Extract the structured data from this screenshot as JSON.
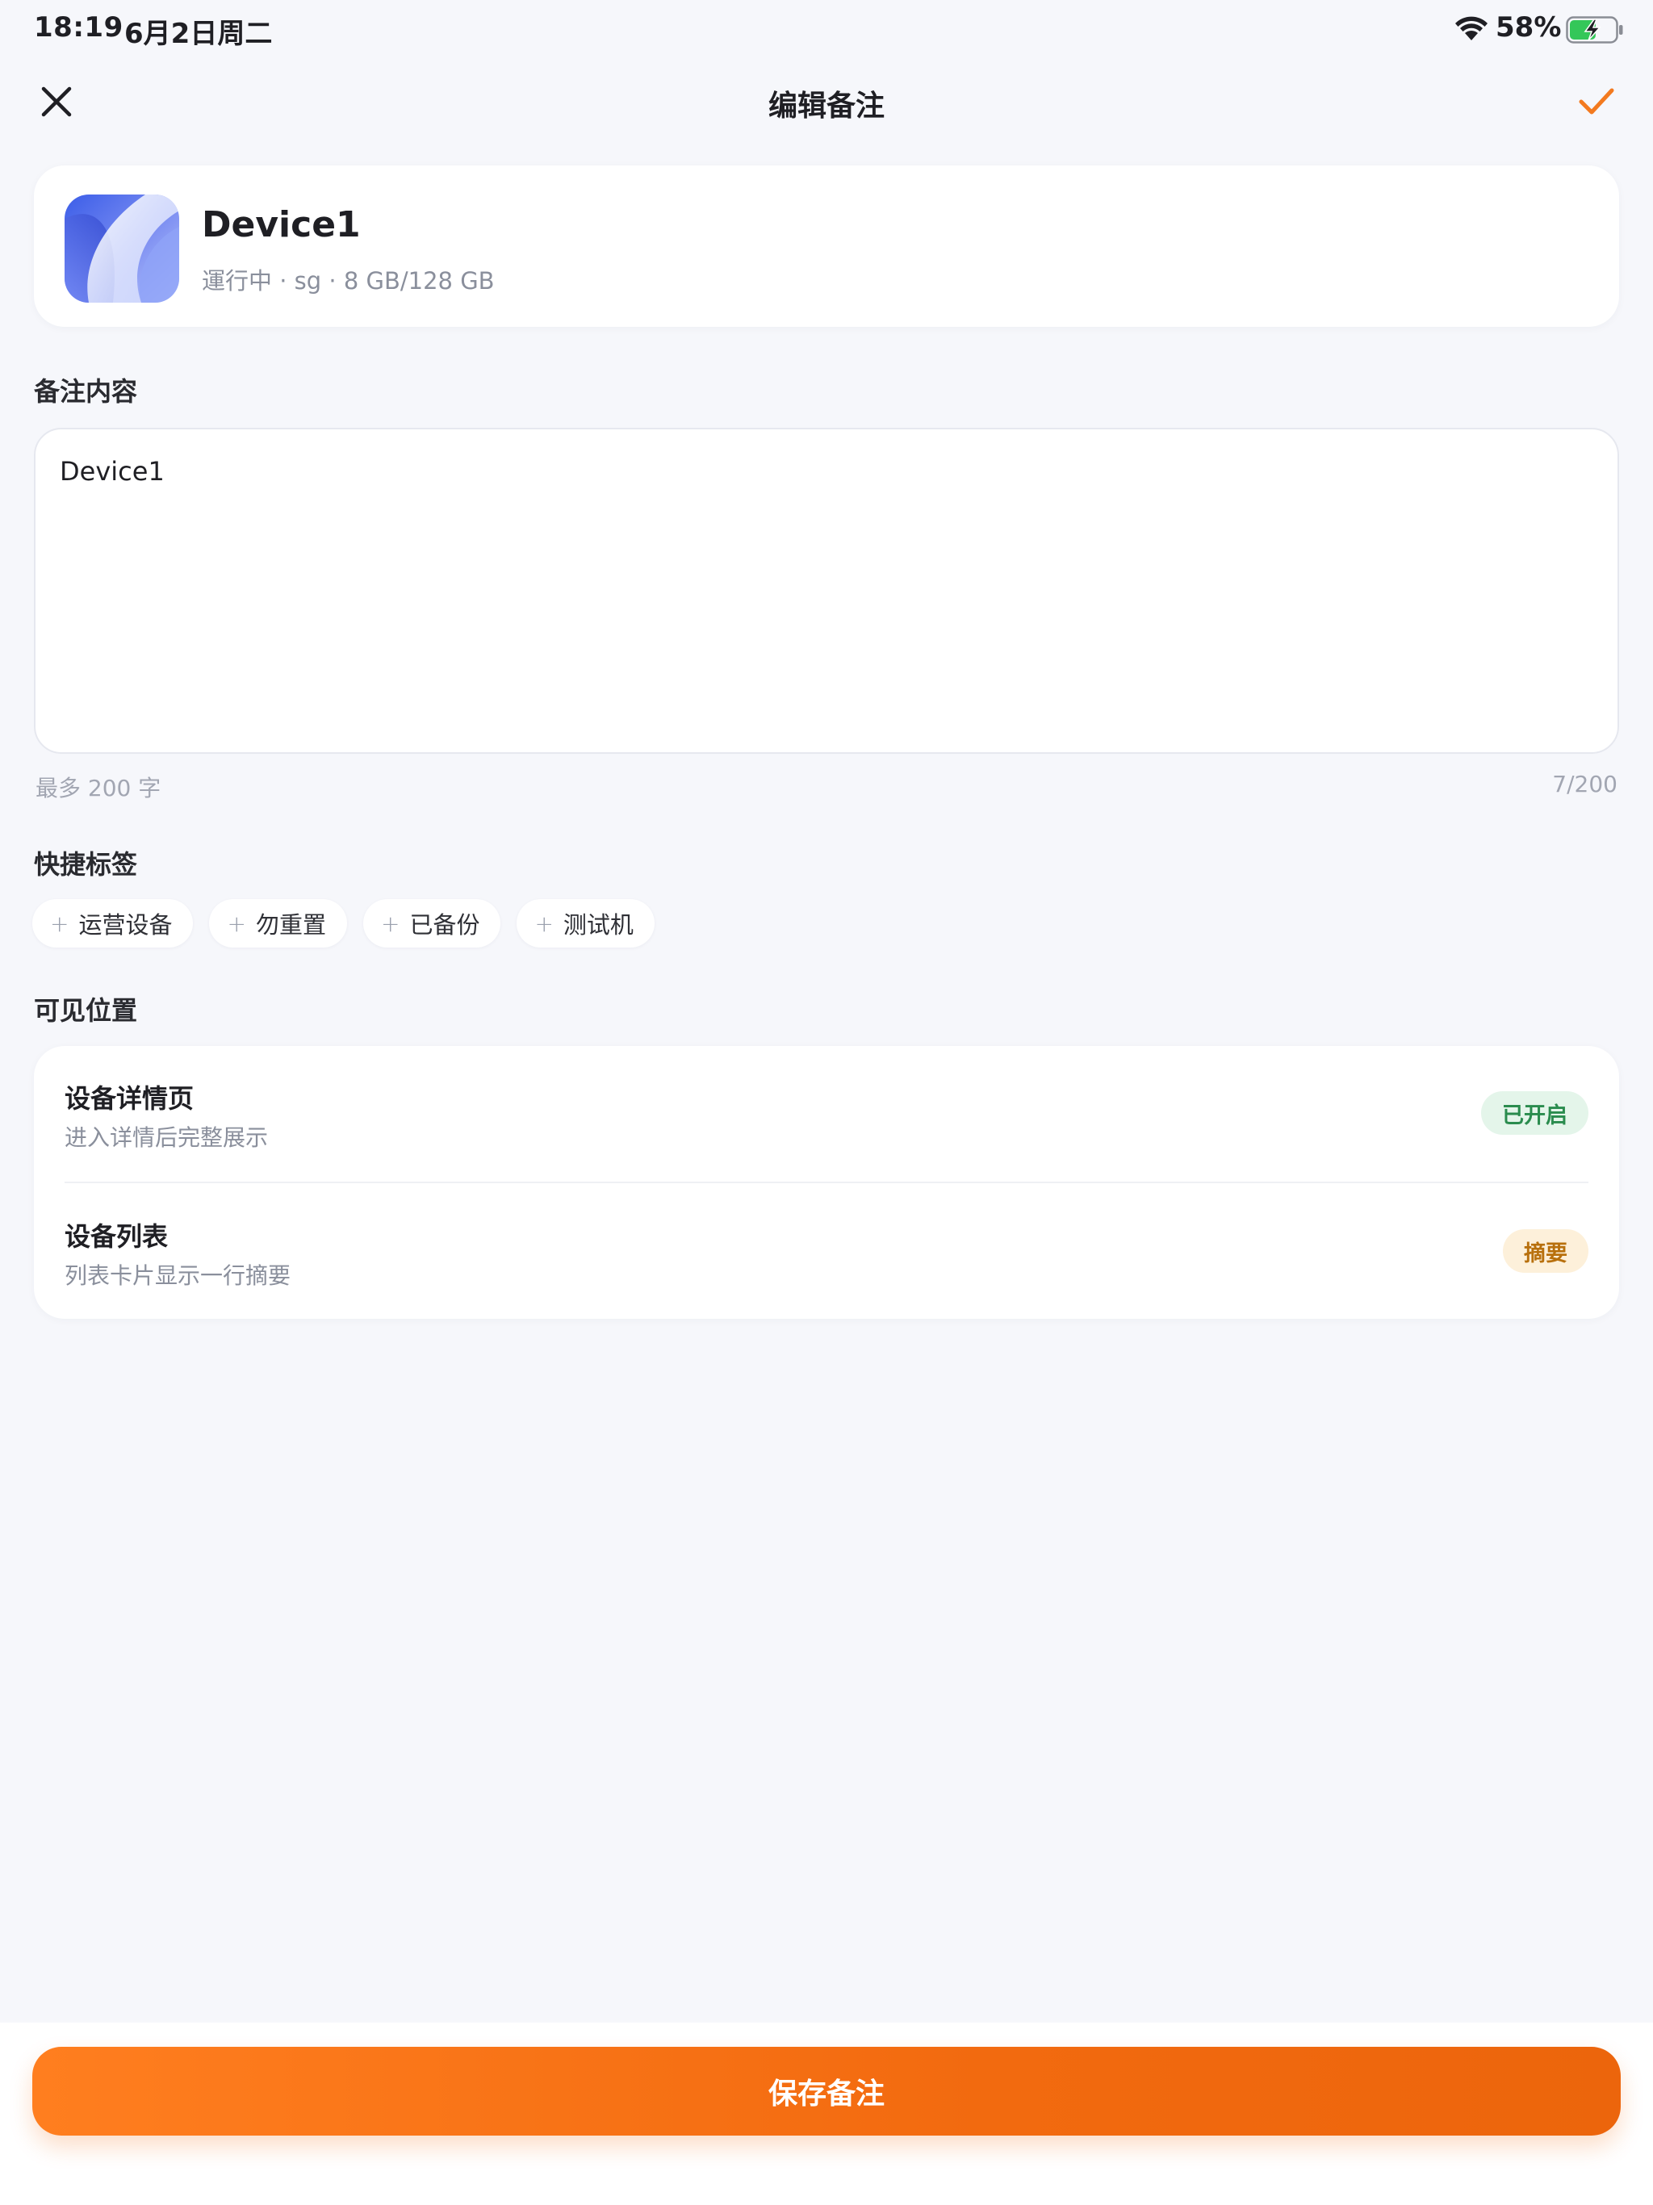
{
  "status_bar": {
    "time": "18:19",
    "date": "6月2日周二",
    "battery_percent": "58%",
    "battery_level": 0.58,
    "charging": true
  },
  "nav": {
    "title": "编辑备注",
    "close_icon": "close-icon",
    "confirm_icon": "check-icon",
    "accent_color": "#f37a1f"
  },
  "device": {
    "name": "Device1",
    "meta": "運行中 · sg · 8 GB/128 GB"
  },
  "note": {
    "section_label": "备注内容",
    "value": "Device1",
    "hint": "最多 200 字",
    "count": "7/200"
  },
  "tags": {
    "section_label": "快捷标签",
    "items": [
      {
        "label": "运营设备"
      },
      {
        "label": "勿重置"
      },
      {
        "label": "已备份"
      },
      {
        "label": "测试机"
      }
    ]
  },
  "visibility": {
    "section_label": "可见位置",
    "rows": [
      {
        "title": "设备详情页",
        "description": "进入详情后完整展示",
        "badge": "已开启",
        "badge_color": "#2a8c4e"
      },
      {
        "title": "设备列表",
        "description": "列表卡片显示一行摘要",
        "badge": "摘要",
        "badge_color": "#b8700d"
      }
    ]
  },
  "save_button": {
    "label": "保存备注",
    "color": "#f26a0f"
  }
}
